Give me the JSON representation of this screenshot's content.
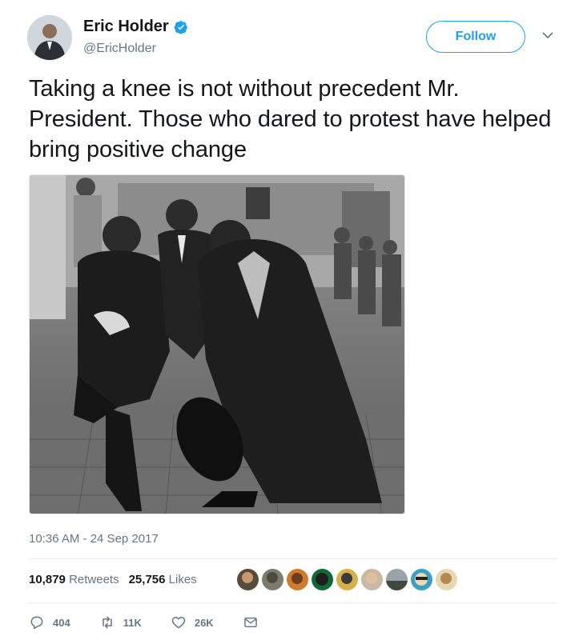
{
  "author": {
    "name": "Eric Holder",
    "handle": "@EricHolder",
    "verified_icon": "verified-badge-icon"
  },
  "follow_button": {
    "label": "Follow"
  },
  "tweet": {
    "text": "Taking a knee is not without precedent Mr. President. Those who dared to protest have helped bring positive change",
    "timestamp": "10:36 AM - 24 Sep 2017"
  },
  "stats": {
    "retweets_count": "10,879",
    "retweets_label": "Retweets",
    "likes_count": "25,756",
    "likes_label": "Likes"
  },
  "actions": {
    "reply_count": "404",
    "retweet_count": "11K",
    "like_count": "26K"
  },
  "colors": {
    "accent": "#1da1f2",
    "text": "#14171a",
    "muted": "#657786"
  }
}
